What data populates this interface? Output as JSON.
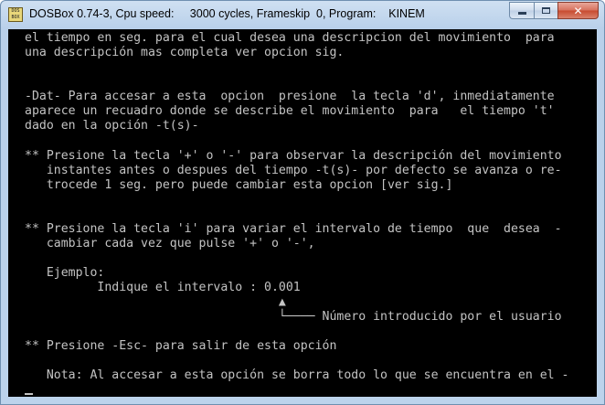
{
  "window": {
    "title": "DOSBox 0.74-3, Cpu speed:     3000 cycles, Frameskip  0, Program:    KINEM",
    "icon_text": "DOS BOX",
    "close_label": "✕"
  },
  "screen": {
    "lines": [
      "el tiempo en seg. para el cual desea una descripcion del movimiento  para",
      "una descripción mas completa ver opcion sig.",
      "-Dat- Para accesar a esta  opcion  presione  la tecla 'd', inmediatamente",
      "aparece un recuadro donde se describe el movimiento  para   el tiempo 't'",
      "dado en la opción -t(s)-",
      "** Presione la tecla '+' o '-' para observar la descripción del movimiento",
      "   instantes antes o despues del tiempo -t(s)- por defecto se avanza o re-",
      "   trocede 1 seg. pero puede cambiar esta opcion [ver sig.]",
      "** Presione la tecla 'i' para variar el intervalo de tiempo  que  desea  -",
      "   cambiar cada vez que pulse '+' o '-',",
      "   Ejemplo:",
      "          Indique el intervalo : 0.001",
      "                                   ▲",
      "                                   └──── Número introducido por el usuario",
      "** Presione -Esc- para salir de esta opción",
      "   Nota: Al accesar a esta opción se borra todo lo que se encuentra en el -"
    ]
  }
}
